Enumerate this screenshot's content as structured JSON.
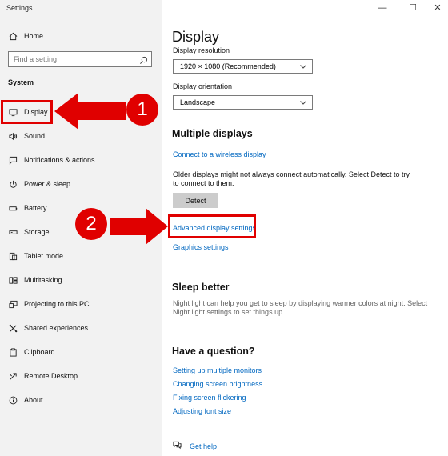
{
  "window": {
    "title": "Settings",
    "minimize": "—",
    "maximize": "☐",
    "close": "✕"
  },
  "sidebar": {
    "home": "Home",
    "search_placeholder": "Find a setting",
    "section": "System",
    "items": [
      {
        "label": "Display",
        "icon": "monitor-icon"
      },
      {
        "label": "Sound",
        "icon": "speaker-icon"
      },
      {
        "label": "Notifications & actions",
        "icon": "notification-icon"
      },
      {
        "label": "Power & sleep",
        "icon": "power-icon"
      },
      {
        "label": "Battery",
        "icon": "battery-icon"
      },
      {
        "label": "Storage",
        "icon": "storage-icon"
      },
      {
        "label": "Tablet mode",
        "icon": "tablet-icon"
      },
      {
        "label": "Multitasking",
        "icon": "multitasking-icon"
      },
      {
        "label": "Projecting to this PC",
        "icon": "projecting-icon"
      },
      {
        "label": "Shared experiences",
        "icon": "shared-icon"
      },
      {
        "label": "Clipboard",
        "icon": "clipboard-icon"
      },
      {
        "label": "Remote Desktop",
        "icon": "remote-icon"
      },
      {
        "label": "About",
        "icon": "info-icon"
      }
    ]
  },
  "main": {
    "title": "Display",
    "resolution_label": "Display resolution",
    "resolution_value": "1920 × 1080 (Recommended)",
    "orientation_label": "Display orientation",
    "orientation_value": "Landscape",
    "multiple_heading": "Multiple displays",
    "wireless_link": "Connect to a wireless display",
    "detect_text": "Older displays might not always connect automatically. Select Detect to try to connect to them.",
    "detect_button": "Detect",
    "advanced_link": "Advanced display settings",
    "graphics_link": "Graphics settings",
    "sleep_heading": "Sleep better",
    "sleep_text": "Night light can help you get to sleep by displaying warmer colors at night. Select Night light settings to set things up.",
    "question_heading": "Have a question?",
    "help_links": [
      "Setting up multiple monitors",
      "Changing screen brightness",
      "Fixing screen flickering",
      "Adjusting font size"
    ],
    "get_help": "Get help"
  },
  "annotations": {
    "step1": "1",
    "step2": "2",
    "highlight_color": "#e00000",
    "link_color": "#0067c0"
  }
}
